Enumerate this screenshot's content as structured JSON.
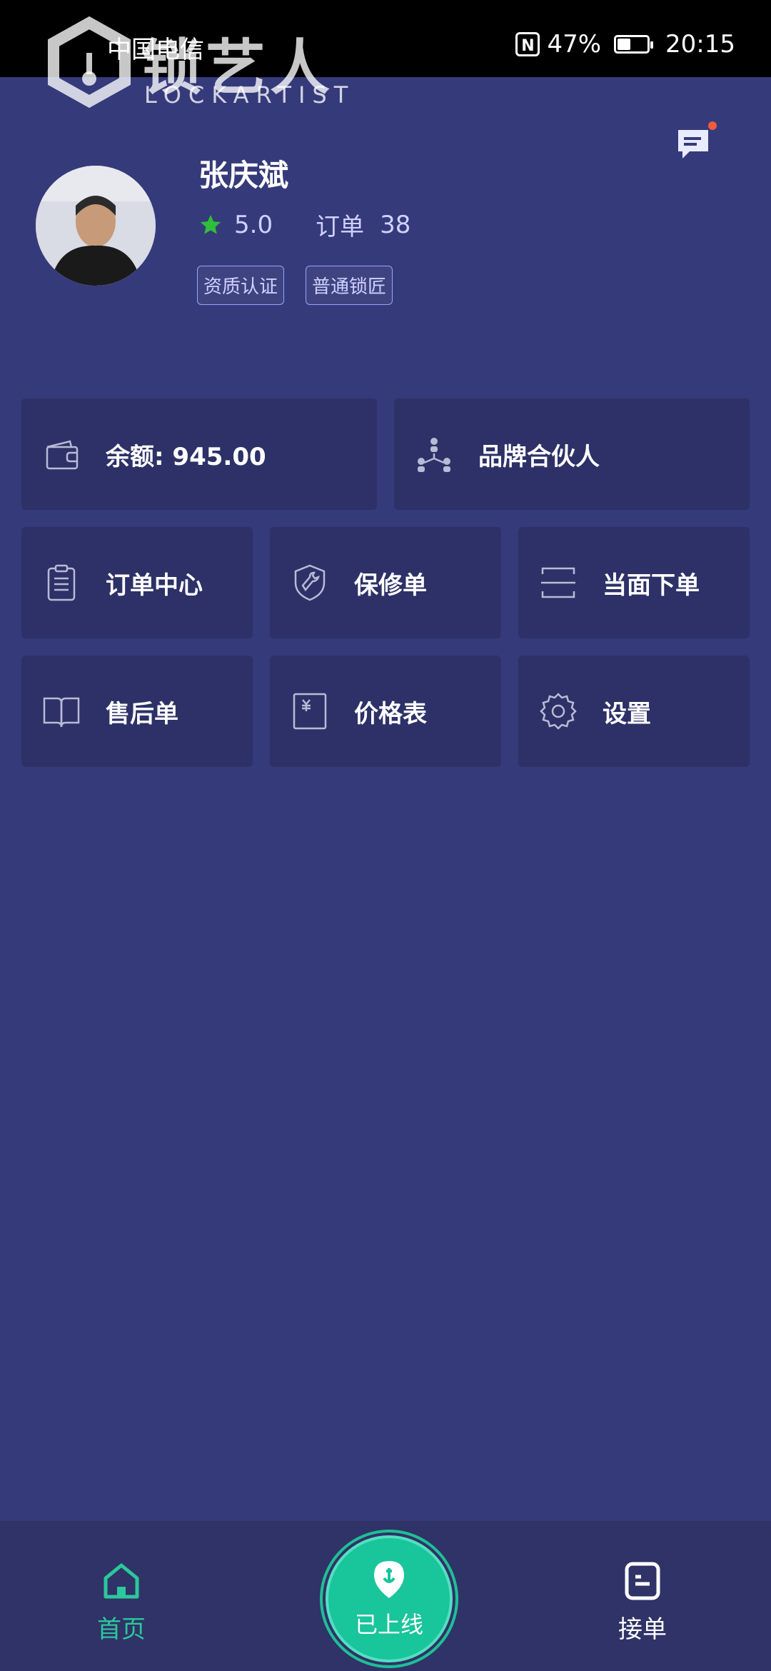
{
  "status_bar": {
    "carrier": "中国电信",
    "battery": "47%",
    "time": "20:15"
  },
  "brand": {
    "name": "锁艺人",
    "sub": "LOCKARTIST"
  },
  "profile": {
    "name": "张庆斌",
    "rating": "5.0",
    "orders_label": "订单",
    "orders_count": "38",
    "tags": [
      "资质认证",
      "普通锁匠"
    ]
  },
  "menu": {
    "balance": "余额:  945.00",
    "brand_partner": "品牌合伙人",
    "order_center": "订单中心",
    "warranty": "保修单",
    "onsite_order": "当面下单",
    "after_sales": "售后单",
    "price_list": "价格表",
    "settings": "设置"
  },
  "bottom_nav": {
    "home": "首页",
    "online": "已上线",
    "take_orders": "接单"
  },
  "colors": {
    "background": "#353a7a",
    "card": "#2d3167",
    "accent": "#19c59a",
    "star": "#2fbf3a"
  }
}
